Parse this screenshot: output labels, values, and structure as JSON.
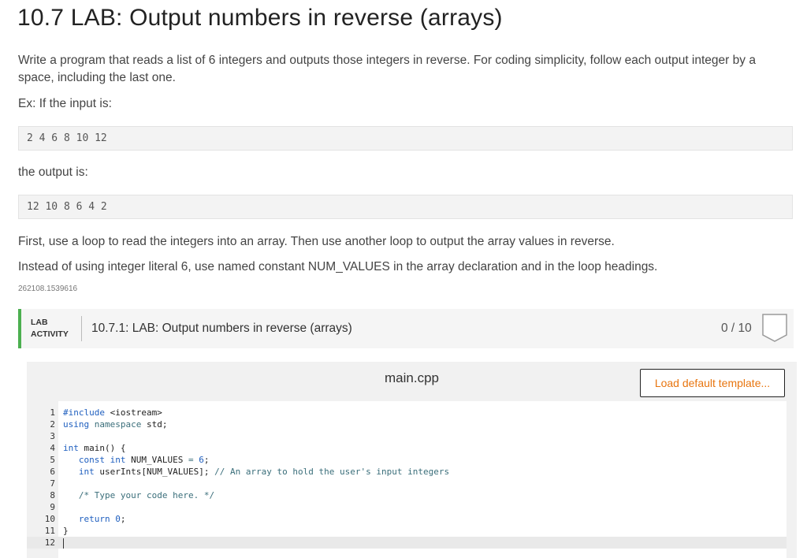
{
  "page": {
    "title": "10.7 LAB: Output numbers in reverse (arrays)",
    "p1": "Write a program that reads a list of 6 integers and outputs those integers in reverse. For coding simplicity, follow each output integer by a space, including the last one.",
    "p2": "Ex: If the input is:",
    "example_input": "2 4 6 8 10 12",
    "p3": "the output is:",
    "example_output": "12 10 8 6 4 2",
    "p4": "First, use a loop to read the integers into an array. Then use another loop to output the array values in reverse.",
    "p5": "Instead of using integer literal 6, use named constant NUM_VALUES in the array declaration and in the loop headings.",
    "id": "262108.1539616"
  },
  "lab": {
    "tag_line1": "LAB",
    "tag_line2": "ACTIVITY",
    "title": "10.7.1: LAB: Output numbers in reverse (arrays)",
    "score": "0 / 10",
    "accent_color": "#4caf50"
  },
  "editor": {
    "filename": "main.cpp",
    "load_button": "Load default template...",
    "load_button_color": "#e8750f",
    "lines": [
      {
        "n": "1",
        "parts": [
          [
            "kw",
            "#include "
          ],
          [
            "txt",
            "<iostream>"
          ]
        ]
      },
      {
        "n": "2",
        "parts": [
          [
            "kw",
            "using "
          ],
          [
            "cm",
            "namespace "
          ],
          [
            "txt",
            "std;"
          ]
        ]
      },
      {
        "n": "3",
        "parts": []
      },
      {
        "n": "4",
        "parts": [
          [
            "kw",
            "int "
          ],
          [
            "txt",
            "main() {"
          ]
        ]
      },
      {
        "n": "5",
        "parts": [
          [
            "txt",
            "   "
          ],
          [
            "kw",
            "const int "
          ],
          [
            "txt",
            "NUM_VALUES "
          ],
          [
            "cm",
            "= "
          ],
          [
            "num",
            "6"
          ],
          [
            "txt",
            ";"
          ]
        ]
      },
      {
        "n": "6",
        "parts": [
          [
            "txt",
            "   "
          ],
          [
            "kw",
            "int "
          ],
          [
            "txt",
            "userInts[NUM_VALUES]; "
          ],
          [
            "cm",
            "// An array to hold the user's input integers"
          ]
        ]
      },
      {
        "n": "7",
        "parts": []
      },
      {
        "n": "8",
        "parts": [
          [
            "txt",
            "   "
          ],
          [
            "cm",
            "/* Type your code here. */"
          ]
        ]
      },
      {
        "n": "9",
        "parts": []
      },
      {
        "n": "10",
        "parts": [
          [
            "txt",
            "   "
          ],
          [
            "kw",
            "return "
          ],
          [
            "num",
            "0"
          ],
          [
            "txt",
            ";"
          ]
        ]
      },
      {
        "n": "11",
        "parts": [
          [
            "txt",
            "}"
          ]
        ]
      },
      {
        "n": "12",
        "parts": []
      }
    ],
    "active_line": "12"
  }
}
